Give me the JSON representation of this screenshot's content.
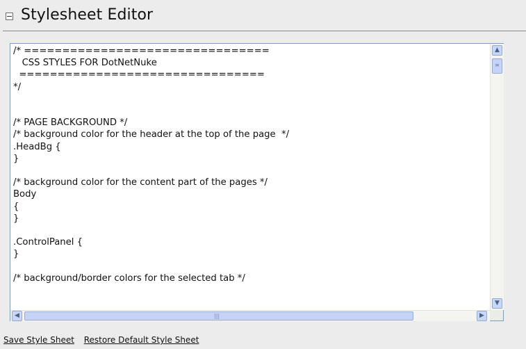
{
  "header": {
    "title": "Stylesheet Editor",
    "collapse_icon": "minus-box-icon"
  },
  "editor": {
    "content": "/* ================================\n   CSS STYLES FOR DotNetNuke\n  ================================\n*/\n\n\n/* PAGE BACKGROUND */\n/* background color for the header at the top of the page  */\n.HeadBg {\n}\n\n/* background color for the content part of the pages */\nBody\n{\n}\n\n.ControlPanel {\n}\n\n/* background/border colors for the selected tab */"
  },
  "scrollbars": {
    "up_icon": "arrow-up-icon",
    "down_icon": "arrow-down-icon",
    "left_icon": "arrow-left-icon",
    "right_icon": "arrow-right-icon"
  },
  "links": {
    "save": "Save Style Sheet",
    "restore": "Restore Default Style Sheet"
  }
}
